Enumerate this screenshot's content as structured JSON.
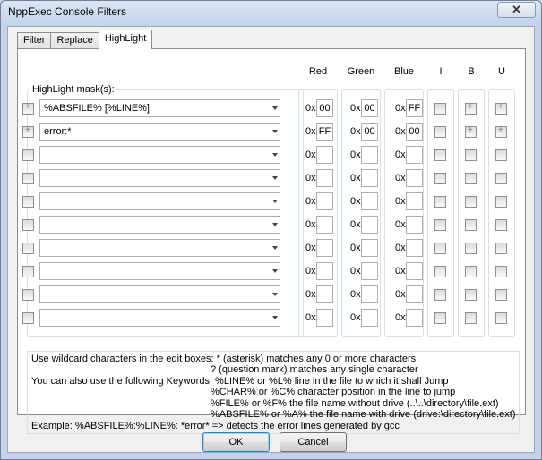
{
  "window": {
    "title": "NppExec Console Filters",
    "close_label": "✕"
  },
  "tabs": [
    {
      "label": "Filter"
    },
    {
      "label": "Replace"
    },
    {
      "label": "HighLight"
    }
  ],
  "highlight": {
    "mask_label": "HighLight mask(s):",
    "headers": {
      "red": "Red",
      "green": "Green",
      "blue": "Blue",
      "italic": "I",
      "bold": "B",
      "underline": "U"
    },
    "hex_prefix": "0x",
    "rows": [
      {
        "mask": "%ABSFILE% [%LINE%]:",
        "red": "00",
        "green": "00",
        "blue": "FF"
      },
      {
        "mask": "error:*",
        "red": "FF",
        "green": "00",
        "blue": "00"
      },
      {
        "mask": "",
        "red": "",
        "green": "",
        "blue": ""
      },
      {
        "mask": "",
        "red": "",
        "green": "",
        "blue": ""
      },
      {
        "mask": "",
        "red": "",
        "green": "",
        "blue": ""
      },
      {
        "mask": "",
        "red": "",
        "green": "",
        "blue": ""
      },
      {
        "mask": "",
        "red": "",
        "green": "",
        "blue": ""
      },
      {
        "mask": "",
        "red": "",
        "green": "",
        "blue": ""
      },
      {
        "mask": "",
        "red": "",
        "green": "",
        "blue": ""
      },
      {
        "mask": "",
        "red": "",
        "green": "",
        "blue": ""
      }
    ]
  },
  "help": {
    "line1": "Use wildcard characters in the edit boxes: * (asterisk) matches any 0 or more characters",
    "line2": "? (question mark) matches any single character",
    "line3": "You can also use the following Keywords: %LINE% or %L%   line in the file to which it shall Jump",
    "line4": "%CHAR% or %C%    character position in the line to jump",
    "line5": "%FILE% or %F%   the file name without drive (..\\..\\directory\\file.ext)",
    "line6": "%ABSFILE% or %A%   the file name with drive (drive:\\directory\\file.ext)",
    "line7": "Example: %ABSFILE%:%LINE%: *error* => detects the error lines generated by gcc"
  },
  "buttons": {
    "ok": "OK",
    "cancel": "Cancel"
  }
}
